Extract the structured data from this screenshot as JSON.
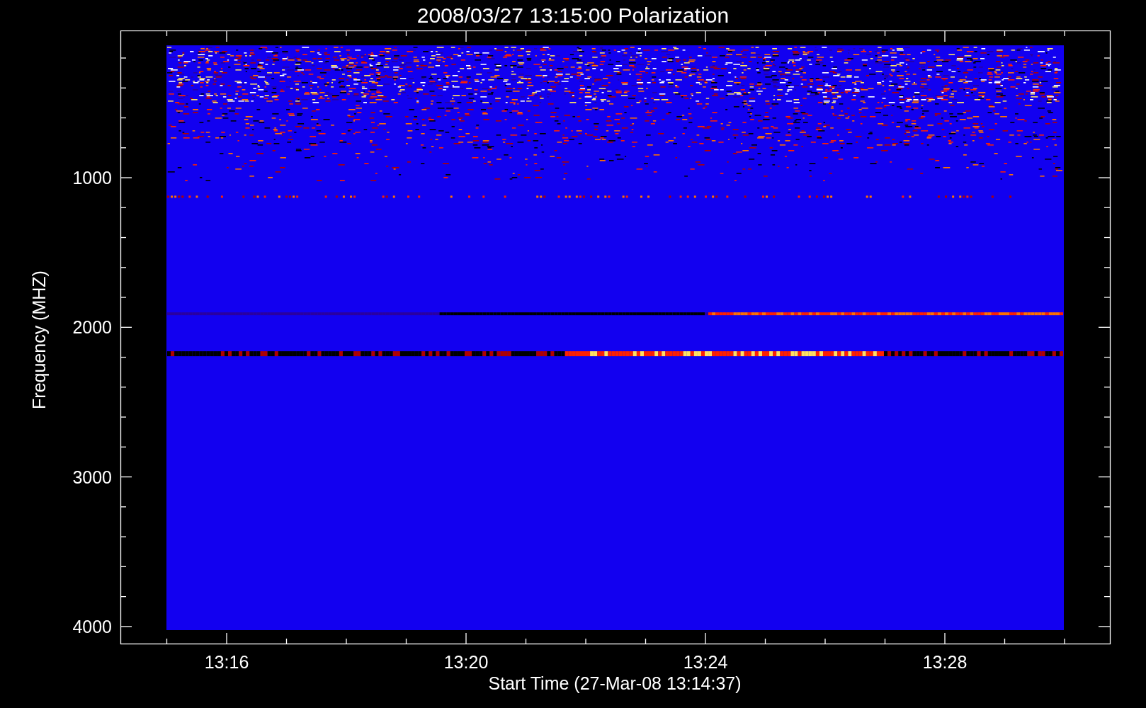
{
  "title": "2008/03/27 13:15:00 Polarization",
  "ylabel": "Frequency (MHZ)",
  "xlabel": "Start Time (27-Mar-08 13:14:37)",
  "yticks": [
    "1000",
    "2000",
    "3000",
    "4000"
  ],
  "xticks": [
    "13:16",
    "13:20",
    "13:24",
    "13:28"
  ]
}
